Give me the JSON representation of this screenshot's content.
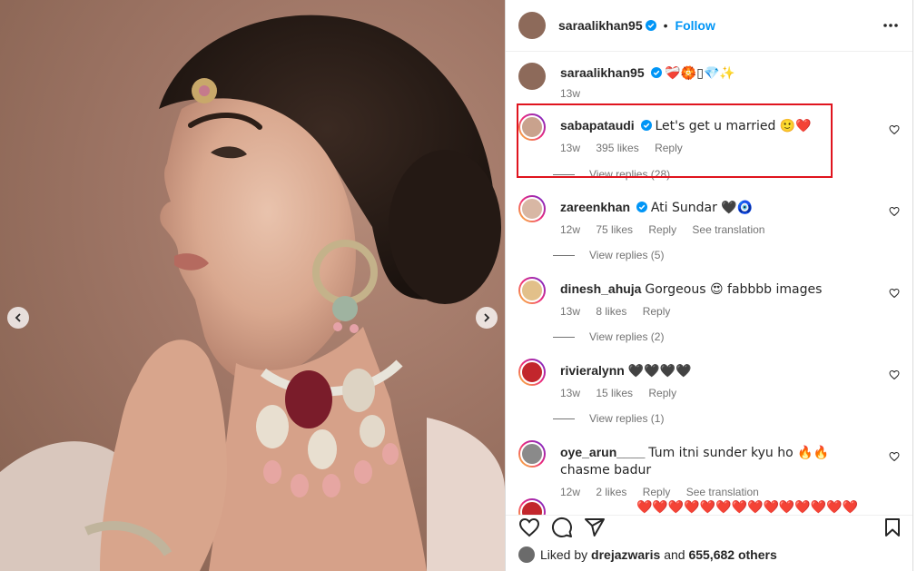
{
  "post": {
    "author": "saraalikhan95",
    "follow_label": "Follow",
    "separator": "•"
  },
  "caption": {
    "username": "saraalikhan95",
    "text": "❤️‍🩹🏵️▯💎✨",
    "time": "13w"
  },
  "comments": [
    {
      "username": "sabapataudi",
      "verified": true,
      "text": "Let's get u married 🙂❤️",
      "time": "13w",
      "likes": "395 likes",
      "reply_label": "Reply",
      "view_replies": "View replies (28)",
      "avatar_color": "#c9a28d"
    },
    {
      "username": "zareenkhan",
      "verified": true,
      "text": "Ati Sundar 🖤🧿",
      "time": "12w",
      "likes": "75 likes",
      "reply_label": "Reply",
      "see_translation": "See translation",
      "view_replies": "View replies (5)",
      "avatar_color": "#d8b7a4"
    },
    {
      "username": "dinesh_ahuja",
      "verified": false,
      "text": "Gorgeous 😍 fabbbb images",
      "time": "13w",
      "likes": "8 likes",
      "reply_label": "Reply",
      "view_replies": "View replies (2)",
      "avatar_color": "#e2c08a"
    },
    {
      "username": "rivieralynn",
      "verified": false,
      "text": "🖤🖤🖤🖤",
      "time": "13w",
      "likes": "15 likes",
      "reply_label": "Reply",
      "view_replies": "View replies (1)",
      "avatar_color": "#c2262c"
    },
    {
      "username": "oye_arun____",
      "verified": false,
      "text": "Tum itni sunder kyu ho 🔥🔥 chasme badur",
      "time": "12w",
      "likes": "2 likes",
      "reply_label": "Reply",
      "see_translation": "See translation",
      "avatar_color": "#8a8a8a"
    },
    {
      "partial_text": "❤️❤️❤️❤️❤️❤️❤️❤️❤️❤️❤️❤️❤️❤️",
      "avatar_color": "#c2262c"
    }
  ],
  "footer": {
    "liked_prefix": "Liked by",
    "liked_user": "drejazwaris",
    "liked_suffix": "and",
    "liked_count": "655,682 others"
  },
  "icons": {
    "like": "heart-icon",
    "comment": "comment-icon",
    "share": "send-icon",
    "save": "bookmark-icon",
    "more": "more-options-icon",
    "verified": "verified-badge-icon"
  },
  "colors": {
    "accent": "#0095f6",
    "highlight_box": "#e0141e",
    "verified": "#0095f6",
    "muted_text": "#737373"
  }
}
